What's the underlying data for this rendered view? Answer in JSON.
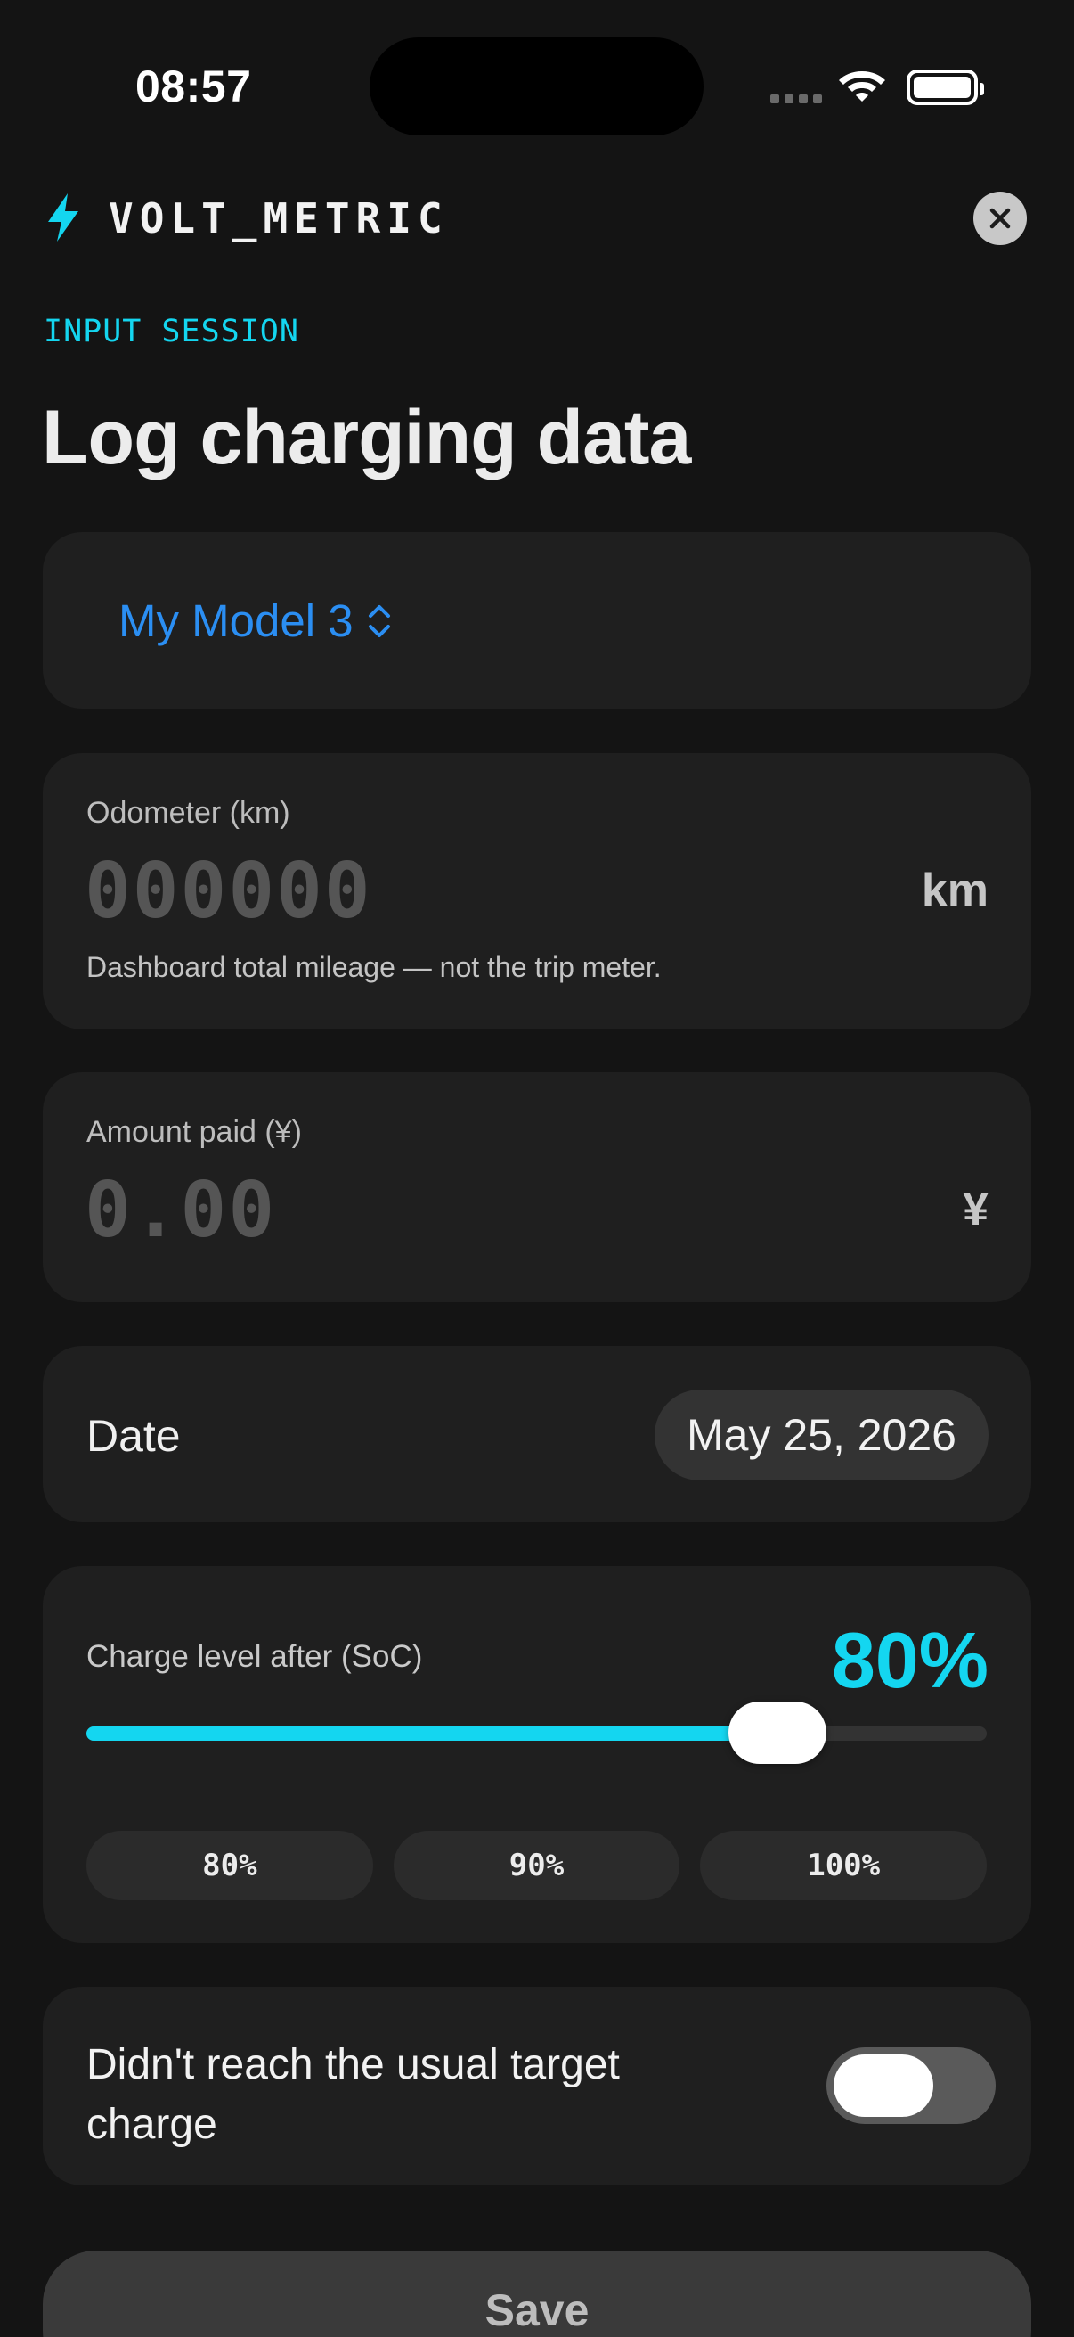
{
  "status_bar": {
    "time": "08:57"
  },
  "header": {
    "brand": "VOLT_METRIC"
  },
  "session_label": "INPUT SESSION",
  "title": "Log charging data",
  "vehicle": {
    "selected": "My Model 3"
  },
  "odometer": {
    "label": "Odometer (km)",
    "placeholder": "000000",
    "value": "",
    "unit": "km",
    "help": "Dashboard total mileage — not the trip meter."
  },
  "amount": {
    "label": "Amount paid (¥)",
    "placeholder": "0.00",
    "value": "",
    "unit": "¥"
  },
  "date": {
    "label": "Date",
    "value": "May 25, 2026"
  },
  "soc": {
    "label": "Charge level after (SoC)",
    "value_text": "80%",
    "value": 80,
    "min": 0,
    "max": 100,
    "presets": [
      "80%",
      "90%",
      "100%"
    ]
  },
  "shortfall": {
    "label": "Didn't reach the usual target charge",
    "on": false
  },
  "save_label": "Save",
  "colors": {
    "accent": "#14d6f0",
    "link": "#2b8ef2",
    "background": "#141414",
    "card": "#1f1f1f"
  }
}
